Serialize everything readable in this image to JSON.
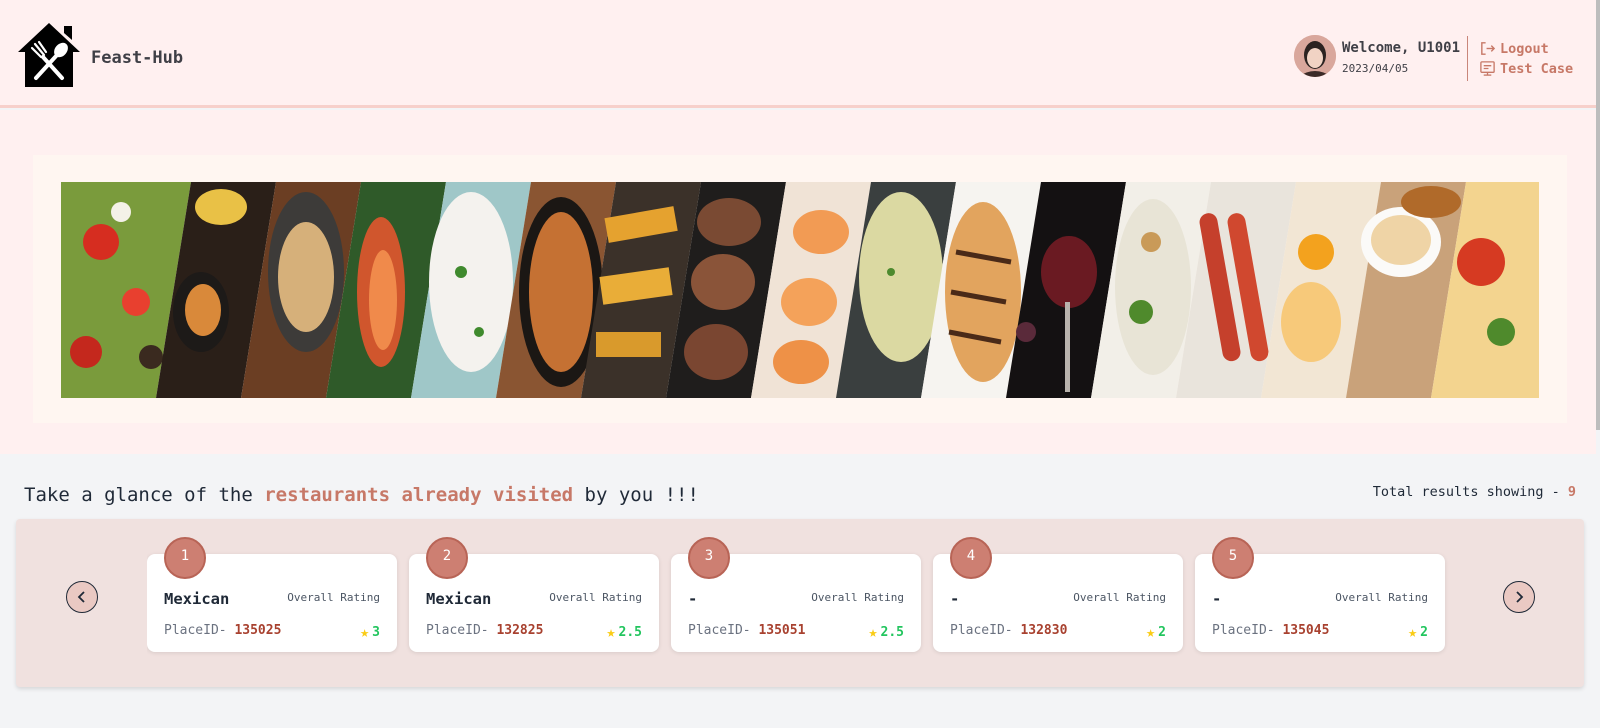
{
  "app": {
    "brand": "Feast-Hub"
  },
  "user": {
    "welcome": "Welcome, U1001",
    "date": "2023/04/05"
  },
  "header_links": {
    "logout": "Logout",
    "test_case": "Test Case"
  },
  "section": {
    "title_prefix": "Take a glance of the ",
    "title_highlight": "restaurants already visited",
    "title_suffix": " by you !!!",
    "total_label": "Total results showing -",
    "total_count": "9"
  },
  "cards": [
    {
      "index": "1",
      "cuisine": "Mexican",
      "rating_label": "Overall Rating",
      "place_label": "PlaceID-",
      "place_id": "135025",
      "rating": "3"
    },
    {
      "index": "2",
      "cuisine": "Mexican",
      "rating_label": "Overall Rating",
      "place_label": "PlaceID-",
      "place_id": "132825",
      "rating": "2.5"
    },
    {
      "index": "3",
      "cuisine": "-",
      "rating_label": "Overall Rating",
      "place_label": "PlaceID-",
      "place_id": "135051",
      "rating": "2.5"
    },
    {
      "index": "4",
      "cuisine": "-",
      "rating_label": "Overall Rating",
      "place_label": "PlaceID-",
      "place_id": "132830",
      "rating": "2"
    },
    {
      "index": "5",
      "cuisine": "-",
      "rating_label": "Overall Rating",
      "place_label": "PlaceID-",
      "place_id": "135045",
      "rating": "2"
    }
  ],
  "colors": {
    "accent": "#c77867",
    "header_bg": "#fff0f0",
    "badge": "#cd7f72",
    "rating_green": "#22c55e",
    "star": "#facc15"
  },
  "icons": [
    "restaurant-logo-icon",
    "logout-icon",
    "test-case-icon",
    "chevron-left-icon",
    "chevron-right-icon",
    "star-icon"
  ]
}
